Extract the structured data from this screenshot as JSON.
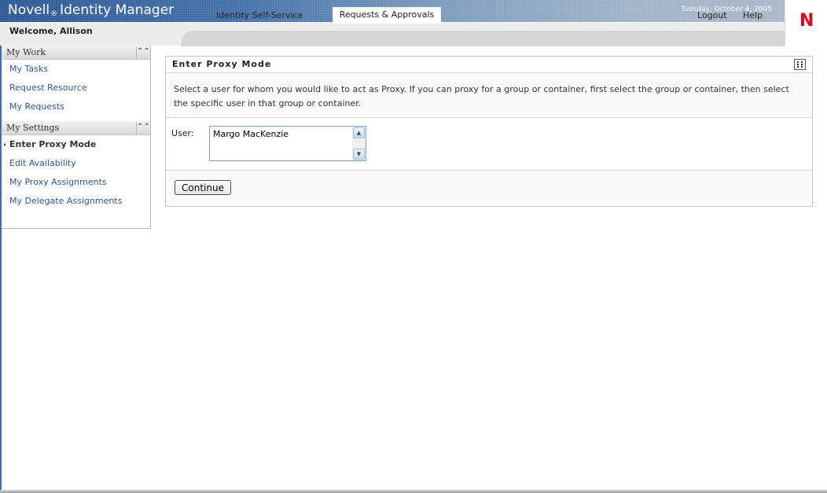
{
  "header": {
    "app_name": "Novell",
    "reg_mark": "®",
    "app_suffix": "Identity Manager",
    "date": "Tuesday, October 4, 2005",
    "welcome": "Welcome, Allison",
    "tabs": [
      {
        "label": "Identity Self-Service",
        "active": false
      },
      {
        "label": "Requests & Approvals",
        "active": true
      }
    ],
    "logout": "Logout",
    "help": "Help",
    "logo_letter": "N",
    "logo_color": "#e2001a"
  },
  "sidebar": {
    "my_work": {
      "title": "My Work",
      "items": [
        "My Tasks",
        "Request Resource",
        "My Requests"
      ]
    },
    "my_settings": {
      "title": "My Settings",
      "items": [
        "Enter Proxy Mode",
        "Edit Availability",
        "My Proxy Assignments",
        "My Delegate Assignments"
      ],
      "active_item": "Enter Proxy Mode"
    },
    "collapse_icon": "double-chevron-up-icon"
  },
  "panel": {
    "title": "Enter Proxy Mode",
    "description": "Select a user for whom you would like to act as Proxy. If you can proxy for a group or container, first select the group or container, then select the specific user in that group or container.",
    "user_label": "User:",
    "user_value": "Margo MacKenzie",
    "continue_label": "Continue"
  },
  "colors": {
    "link": "#2b5797",
    "header_blue": "#24518f"
  }
}
